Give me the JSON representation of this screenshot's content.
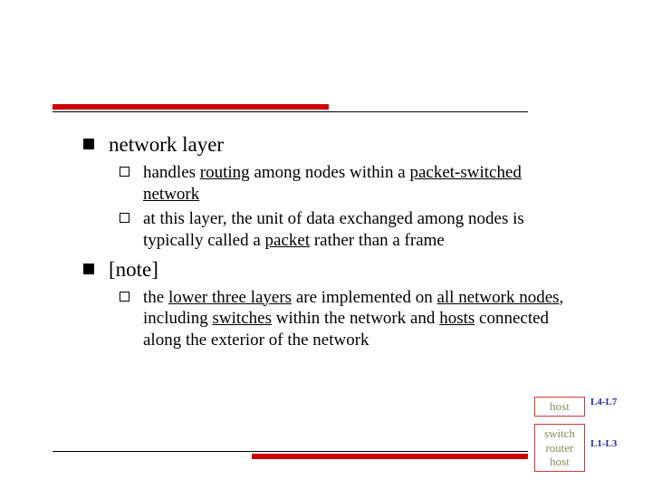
{
  "items": [
    {
      "label": "network layer",
      "sub": [
        {
          "pre": "handles ",
          "u1": "routing",
          "mid1": " among nodes within a ",
          "u2": "packet-switched",
          "mid2": " ",
          "u3": "network",
          "post": ""
        },
        {
          "pre": "at this layer, the unit of data exchanged among nodes is typically called a ",
          "u1": "packet",
          "post": " rather than a frame"
        }
      ]
    },
    {
      "label": "[note]",
      "sub": [
        {
          "pre": "the ",
          "u1": "lower three layers",
          "mid1": " are implemented on ",
          "u2": "all network nodes",
          "mid2": ", including ",
          "u3": "switches",
          "mid3": " within the network and ",
          "u4": "hosts",
          "post": " connected along the exterior of the network"
        }
      ]
    }
  ],
  "callouts": {
    "box1_line1": "host",
    "box2_line1": "switch",
    "box2_line2": "router",
    "box2_line3": "host",
    "label1": "L4-L7",
    "label2": "L1-L3"
  }
}
